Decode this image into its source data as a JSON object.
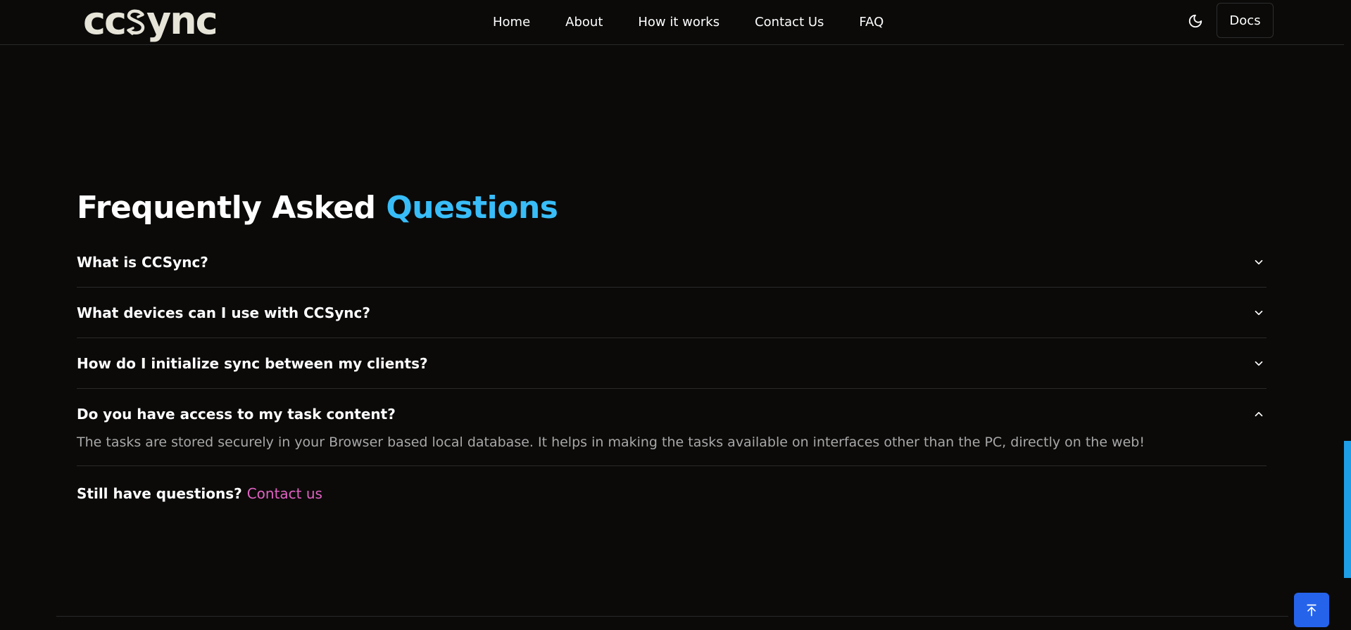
{
  "header": {
    "logo_text": "ccsync",
    "nav": [
      "Home",
      "About",
      "How it works",
      "Contact Us",
      "FAQ"
    ],
    "docs_label": "Docs"
  },
  "faq": {
    "title_main": "Frequently Asked",
    "title_accent": "Questions",
    "items": [
      {
        "question": "What is CCSync?",
        "expanded": false,
        "answer": ""
      },
      {
        "question": "What devices can I use with CCSync?",
        "expanded": false,
        "answer": ""
      },
      {
        "question": "How do I initialize sync between my clients?",
        "expanded": false,
        "answer": ""
      },
      {
        "question": "Do you have access to my task content?",
        "expanded": true,
        "answer": "The tasks are stored securely in your Browser based local database. It helps in making the tasks available on interfaces other than the PC, directly on the web!"
      }
    ],
    "still_questions": "Still have questions?",
    "contact_link": "Contact us"
  },
  "colors": {
    "background": "#0b0a09",
    "accent_blue": "#38bdf8",
    "link_pink": "#e062c2",
    "button_blue": "#2563eb",
    "logo": "#e6e4d8"
  },
  "icons": {
    "theme_toggle": "moon-icon",
    "accordion_collapsed": "chevron-down-icon",
    "accordion_expanded": "chevron-up-icon",
    "scroll_top": "arrow-up-to-line-icon"
  }
}
